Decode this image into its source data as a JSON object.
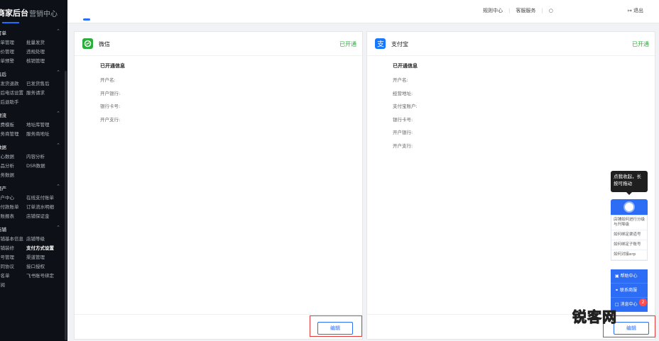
{
  "brand": {
    "title": "商家后台",
    "marketing": "营销中心"
  },
  "sidebar": {
    "sections": [
      {
        "title": "订单",
        "rows": [
          [
            "订单管理",
            "批量发货"
          ],
          [
            "评价管理",
            "违规处理"
          ],
          [
            "订单预警",
            "核销管理"
          ]
        ]
      },
      {
        "title": "售后",
        "rows": [
          [
            "未发货退款",
            "已发货售后"
          ],
          [
            "售后电话设置",
            "服务请求"
          ],
          [
            "售后退助手",
            ""
          ]
        ]
      },
      {
        "title": "物流",
        "rows": [
          [
            "运费模板",
            "地址库管理"
          ],
          [
            "服务商管理",
            "服务商地址"
          ]
        ]
      },
      {
        "title": "数据",
        "rows": [
          [
            "核心数据",
            "内容分析"
          ],
          [
            "商品分析",
            "DSR数据"
          ],
          [
            "服务数据",
            ""
          ]
        ]
      },
      {
        "title": "资产",
        "rows": [
          [
            "账户中心",
            "在线支付账单"
          ],
          [
            "待付款账单",
            "订单流水明细"
          ],
          [
            "对账报表",
            "店铺保证金"
          ]
        ]
      },
      {
        "title": "店铺",
        "rows": [
          [
            "店铺基本信息",
            "店铺等级"
          ],
          [
            "店铺装修",
            "支付方式设置"
          ],
          [
            "账号管理",
            "渠道管理"
          ],
          [
            "合同协议",
            "接口授权"
          ],
          [
            "签名单",
            "飞书账号绑定"
          ],
          [
            "订阅",
            ""
          ]
        ]
      }
    ],
    "active": "支付方式设置"
  },
  "topbar": {
    "rules": "规则中心",
    "service": "客服服务",
    "user": "ጰ",
    "logout": "退出"
  },
  "wechat": {
    "name": "微信",
    "state": "已开通",
    "subtitle": "已开通信息",
    "fields": [
      "开户名:",
      "开户银行:",
      "银行卡号:",
      "开户支行:"
    ],
    "edit": "编辑"
  },
  "alipay": {
    "name": "支付宝",
    "state": "已开通",
    "subtitle": "已开通信息",
    "fields": [
      "开户名:",
      "经营地址:",
      "支付宝账户:",
      "银行卡号:",
      "开户银行:",
      "开户支行:"
    ],
    "edit": "编辑"
  },
  "helper": {
    "tip": "点我收起，长按可拖动",
    "items": [
      "店铺如何进行分级与升降级",
      "如何绑定渠道号",
      "如何绑定子账号",
      "如何对接erp"
    ],
    "buttons": [
      "帮助中心",
      "联系商服",
      "消息中心"
    ],
    "badge": "2"
  },
  "watermark": "锐客网",
  "colors": {
    "accent": "#2d6df6",
    "success": "#2aae3a",
    "highlight": "#e53935",
    "wechat": "#2aae3a",
    "alipay": "#1677ff"
  }
}
